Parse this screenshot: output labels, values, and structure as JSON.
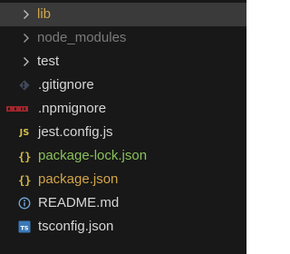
{
  "explorer": {
    "items": [
      {
        "label": "lib",
        "type": "folder",
        "icon": "chevron-right-icon",
        "color": "#d2a54a",
        "selected": true
      },
      {
        "label": "node_modules",
        "type": "folder",
        "icon": "chevron-right-icon",
        "color": "#7b7b7b",
        "selected": false
      },
      {
        "label": "test",
        "type": "folder",
        "icon": "chevron-right-icon",
        "color": "#d6d6d6",
        "selected": false
      },
      {
        "label": ".gitignore",
        "type": "file",
        "icon": "git-icon",
        "color": "#d6d6d6",
        "selected": false
      },
      {
        "label": ".npmignore",
        "type": "file",
        "icon": "npm-icon",
        "color": "#d6d6d6",
        "selected": false
      },
      {
        "label": "jest.config.js",
        "type": "file",
        "icon": "javascript-icon",
        "icon_text": "JS",
        "color": "#d6d6d6",
        "selected": false
      },
      {
        "label": "package-lock.json",
        "type": "file",
        "icon": "json-icon",
        "icon_text": "{}",
        "color": "#89c15a",
        "selected": false
      },
      {
        "label": "package.json",
        "type": "file",
        "icon": "json-icon",
        "icon_text": "{}",
        "color": "#d2a54a",
        "selected": false
      },
      {
        "label": "README.md",
        "type": "file",
        "icon": "info-icon",
        "color": "#d6d6d6",
        "selected": false
      },
      {
        "label": "tsconfig.json",
        "type": "file",
        "icon": "typescript-config-icon",
        "color": "#d6d6d6",
        "selected": false
      }
    ]
  }
}
